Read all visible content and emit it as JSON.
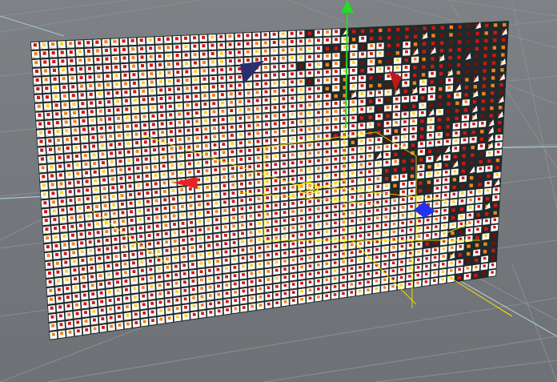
{
  "viewport": {
    "name": "3d-perspective-viewport",
    "background": "#777a7e",
    "grid_color": "#8b8e92",
    "axis_color": "#a9c6d6"
  },
  "scene": {
    "object": "clone-grid-plane",
    "plane_edge_color": "#1f2a2a",
    "tile_colors": {
      "white": "#ffffff",
      "red": "#d41414",
      "orange": "#f0821e",
      "yellow": "#f5d12a",
      "dark": "#2e2a28",
      "dark_red": "#7a0c0c"
    },
    "selection_color": "#ffe600"
  },
  "gizmo": {
    "y_axis_color": "#22dd22",
    "x_axis_color": "#e82222",
    "z_axis_color": "#2233ee",
    "handle_colors": [
      "#2a2f6e",
      "#c01818"
    ]
  }
}
